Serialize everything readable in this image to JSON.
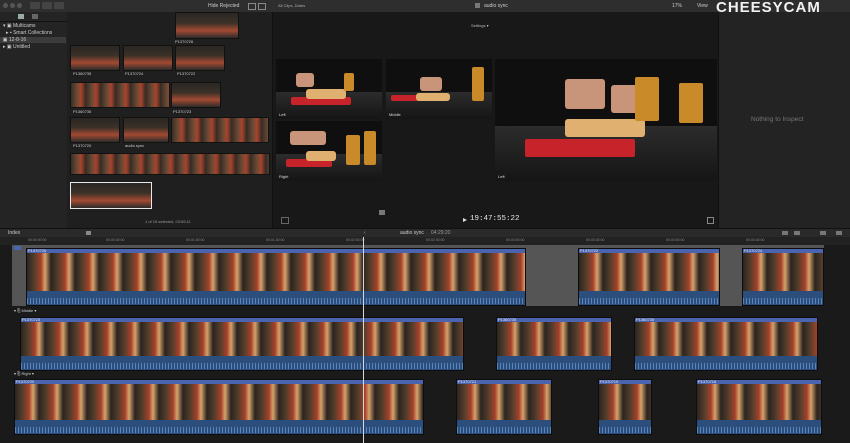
{
  "toolbar": {
    "filter_label": "Hide Rejected",
    "browser_filter": "All Clips, Dates",
    "viewer_title": "audio sync",
    "settings_label": "Settings",
    "zoom": "17%",
    "view_label": "View"
  },
  "libraries": {
    "items": [
      {
        "label": "Multicams"
      },
      {
        "label": "Smart Collections"
      },
      {
        "label": "12-8-16"
      },
      {
        "label": "Untitled"
      }
    ]
  },
  "browser": {
    "clips": [
      {
        "label": "P1370726"
      },
      {
        "label": "P1360735"
      },
      {
        "label": "P1370724"
      },
      {
        "label": "P1370722"
      },
      {
        "label": "P1360735"
      },
      {
        "label": "P1370723"
      },
      {
        "label": "P1370720"
      },
      {
        "label": "audio sync"
      }
    ],
    "status": "1 of 15 selected, 03:59:11"
  },
  "viewer": {
    "angles": [
      {
        "label": "Left"
      },
      {
        "label": "Middle"
      },
      {
        "label": "Right"
      },
      {
        "label": "Left"
      }
    ],
    "timecode": "19:47:55:22"
  },
  "inspector": {
    "empty_text": "Nothing to Inspect"
  },
  "timeline": {
    "index_label": "Index",
    "title": "audio sync",
    "duration": "04:29:20",
    "ruler_ticks": [
      "00:00:00:00",
      "00:00:30:00",
      "00:01:00:00",
      "00:01:30:00",
      "00:02:00:00",
      "00:02:30:00",
      "00:03:00:00",
      "00:03:30:00",
      "00:04:00:00",
      "00:04:30:00"
    ],
    "tracks": [
      {
        "name": "Left",
        "clips": [
          "P1370726",
          "P1370722",
          "P1370724"
        ]
      },
      {
        "name": "Middle",
        "clips": [
          "P1370723",
          "P1360735",
          "P1360735"
        ]
      },
      {
        "name": "Right",
        "clips": [
          "P1370720",
          "P1370721",
          "P1370719",
          "P1370718"
        ]
      }
    ]
  },
  "watermark": "CHEESYCAM",
  "colors": {
    "accent": "#4a64b0",
    "audio": "#2c4e7c",
    "cutting_board": "#c6242a"
  }
}
